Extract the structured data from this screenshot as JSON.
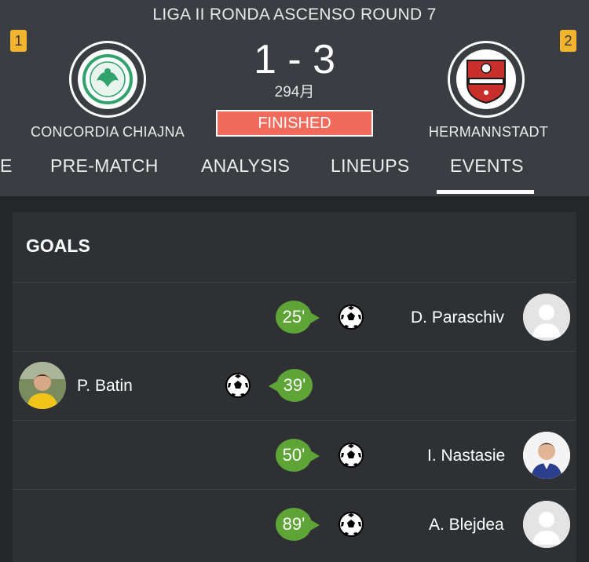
{
  "match": {
    "league_title": "LIGA II  RONDA ASCENSO ROUND 7",
    "home": {
      "name": "CONCORDIA CHIAJNA",
      "rank": "1",
      "crest_color": "#2fa36b"
    },
    "away": {
      "name": "HERMANNSTADT",
      "rank": "2",
      "crest_color": "#c9302c"
    },
    "score": "1 - 3",
    "minute": "294月",
    "status": "FINISHED"
  },
  "tabs": [
    {
      "label": "E"
    },
    {
      "label": "PRE-MATCH"
    },
    {
      "label": "ANALYSIS"
    },
    {
      "label": "LINEUPS"
    },
    {
      "label": "EVENTS",
      "active": true
    }
  ],
  "section": {
    "title": "GOALS"
  },
  "goals": [
    {
      "minute": "25'",
      "player": "D. Paraschiv",
      "side": "away",
      "avatar": "placeholder"
    },
    {
      "minute": "39'",
      "player": "P. Batin",
      "side": "home",
      "avatar": "photo"
    },
    {
      "minute": "50'",
      "player": "I. Nastasie",
      "side": "away",
      "avatar": "photo"
    },
    {
      "minute": "89'",
      "player": "A. Blejdea",
      "side": "away",
      "avatar": "placeholder"
    }
  ],
  "colors": {
    "header_bg": "#3a3d42",
    "page_bg": "#242629",
    "minute_bubble": "#5fa437",
    "status_bg": "#f26a5c",
    "rank_badge": "#f2b42f"
  },
  "icons": {
    "goal": "soccer-ball-icon",
    "crest": "team-crest-icon",
    "avatar": "player-avatar-icon"
  }
}
